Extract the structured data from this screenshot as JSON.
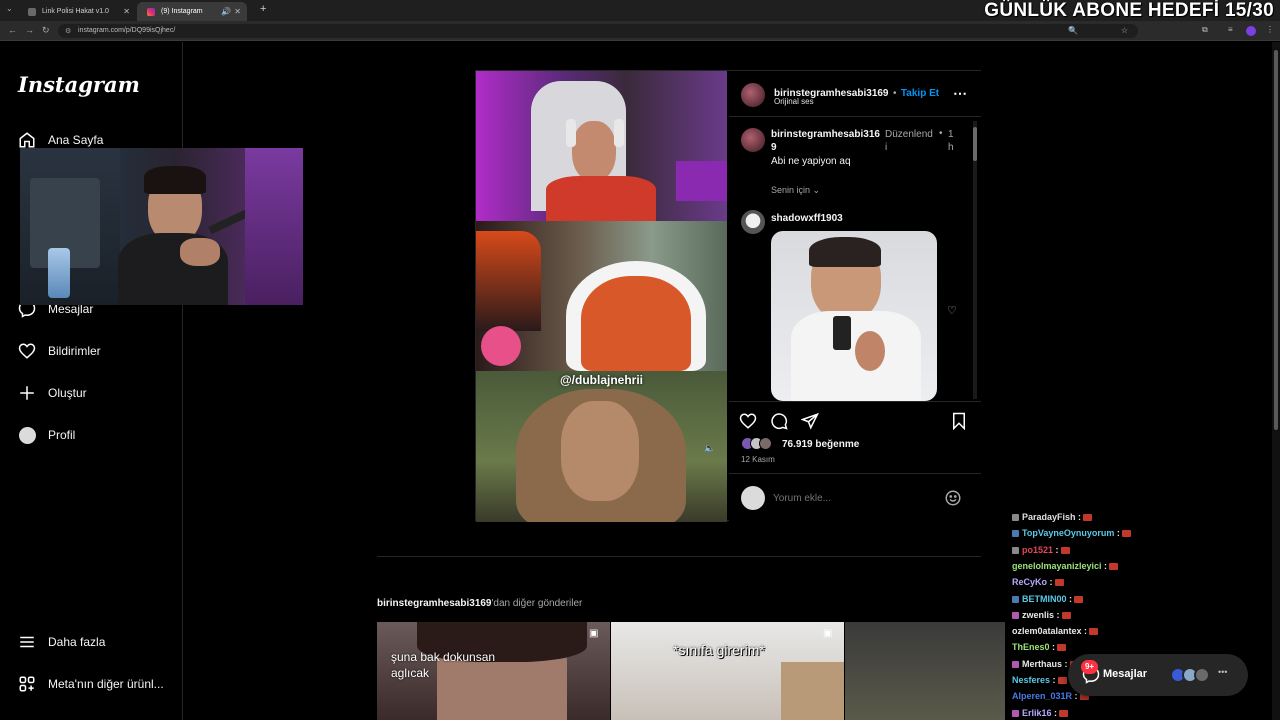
{
  "browser": {
    "tabs": [
      {
        "title": "Link Polisi Hakat v1.0"
      },
      {
        "title": "(9) Instagram"
      }
    ],
    "url": "instagram.com/p/DQ99isQjhec/"
  },
  "overlay": {
    "goal_text": "GÜNLÜK ABONE HEDEFİ 15/30"
  },
  "sidebar": {
    "logo": "Instagram",
    "items": [
      {
        "label": "Ana Sayfa",
        "icon": "home-icon"
      },
      {
        "label": "Mesajlar",
        "icon": "messenger-icon"
      },
      {
        "label": "Bildirimler",
        "icon": "heart-icon"
      },
      {
        "label": "Oluştur",
        "icon": "plus-icon"
      },
      {
        "label": "Profil",
        "icon": "profile-avatar"
      }
    ],
    "bottom_items": [
      {
        "label": "Daha fazla",
        "icon": "hamburger-icon"
      },
      {
        "label": "Meta'nın diğer ürünl...",
        "icon": "meta-apps-icon"
      }
    ]
  },
  "post": {
    "media_watermark": "@/dublajnehrii",
    "header": {
      "username": "birinstegramhesabi3169",
      "separator": "•",
      "follow_label": "Takip Et",
      "audio": "Orijinal ses"
    },
    "caption": {
      "username_line1": "birinstegramhesabi316",
      "username_line2": "9",
      "edited_line1": "Düzenlend",
      "edited_line2": "i",
      "bullet": "•",
      "time_line1": "1",
      "time_line2": "h",
      "text": "Abi ne yapiyon aq"
    },
    "for_you_label": "Senin için",
    "comment": {
      "username": "shadowxff1903"
    },
    "likes": "76.919 beğenme",
    "date": "12 Kasım",
    "comment_placeholder": "Yorum ekle..."
  },
  "more_posts": {
    "username": "birinstegramhesabi3169",
    "suffix": "'dan diğer gönderiler",
    "captions": [
      "şuna bak dokunsan\naglıcak",
      "*sınıfa girerim*"
    ]
  },
  "chat": [
    {
      "user": "ParadayFish",
      "sep": " :",
      "color": "#e0e0e0",
      "badge": "#888888"
    },
    {
      "user": "TopVayneOynuyorum",
      "sep": " :",
      "color": "#5bc8e8",
      "badge": "#4a7ab0"
    },
    {
      "user": "po1521",
      "sep": " :",
      "color": "#e0475b",
      "badge": "#8a8a8a"
    },
    {
      "user": "genelolmayanizleyici",
      "sep": " :",
      "color": "#9be37a",
      "badge": ""
    },
    {
      "user": "ReCyKo",
      "sep": " :",
      "color": "#b8a8ff",
      "badge": ""
    },
    {
      "user": "BETMIN00",
      "sep": " :",
      "color": "#5bc8e8",
      "badge": "#4a7ab0"
    },
    {
      "user": "zwenlis",
      "sep": " :",
      "color": "#e8e8e8",
      "badge": "#b05ab0"
    },
    {
      "user": "ozlem0atalantex",
      "sep": " :",
      "color": "#e8e8e8",
      "badge": ""
    },
    {
      "user": "ThEnes0",
      "sep": " :",
      "color": "#9be37a",
      "badge": ""
    },
    {
      "user": "Merthaus",
      "sep": " :",
      "color": "#e8e8e8",
      "badge": "#b05ab0"
    },
    {
      "user": "Nesferes",
      "sep": " :",
      "color": "#5bc8e8",
      "badge": ""
    },
    {
      "user": "Alperen_031R",
      "sep": " :",
      "color": "#4a7ae8",
      "badge": ""
    },
    {
      "user": "Erlik16",
      "sep": " :",
      "color": "#b8a8ff",
      "badge": "#b05ab0"
    }
  ],
  "messages_pill": {
    "label": "Mesajlar",
    "badge": "9+"
  }
}
